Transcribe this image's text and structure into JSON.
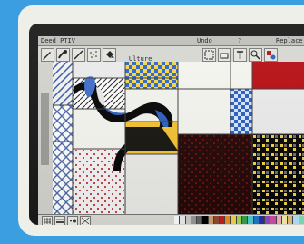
{
  "app": {
    "title_bar_text": "Deed PTIV",
    "menu_undo": "Undo",
    "menu_replace": "Replace",
    "menu_mark": "?",
    "tool_strip_label": "Ulture"
  },
  "colors": {
    "background": "#3a9ee0",
    "bezel": "#efefea",
    "screen": "#1a1a1a",
    "ui_gray": "#d9d9d4",
    "accent_red": "#b80f14",
    "accent_yellow": "#f1cf3d",
    "accent_blue": "#2d5fbe"
  },
  "toolbar": {
    "tools": [
      {
        "name": "pencil-icon"
      },
      {
        "name": "brush-icon"
      },
      {
        "name": "line-icon"
      },
      {
        "name": "spray-icon"
      },
      {
        "name": "fill-icon"
      },
      {
        "name": "select-icon"
      },
      {
        "name": "eraser-icon"
      },
      {
        "name": "text-icon"
      },
      {
        "name": "zoom-icon"
      },
      {
        "name": "shapes-icon"
      }
    ]
  },
  "bottom_tools": [
    {
      "name": "grid-icon"
    },
    {
      "name": "line-width-icon"
    },
    {
      "name": "brush-size-icon"
    },
    {
      "name": "pattern-icon"
    }
  ],
  "palette": [
    "#ffffff",
    "#ededed",
    "#cccccc",
    "#999999",
    "#666666",
    "#000000",
    "#d7a06d",
    "#8f4c2f",
    "#c61e1e",
    "#f78b1e",
    "#f3d64a",
    "#a6d94f",
    "#3e9e49",
    "#4fd0d9",
    "#2477c8",
    "#2a2f9f",
    "#8f4bbf",
    "#d04ea3",
    "#f4b4c8",
    "#f9f1a5",
    "#e7c082",
    "#b3e4ff",
    "#7fe1b6",
    "#a18d7b"
  ]
}
